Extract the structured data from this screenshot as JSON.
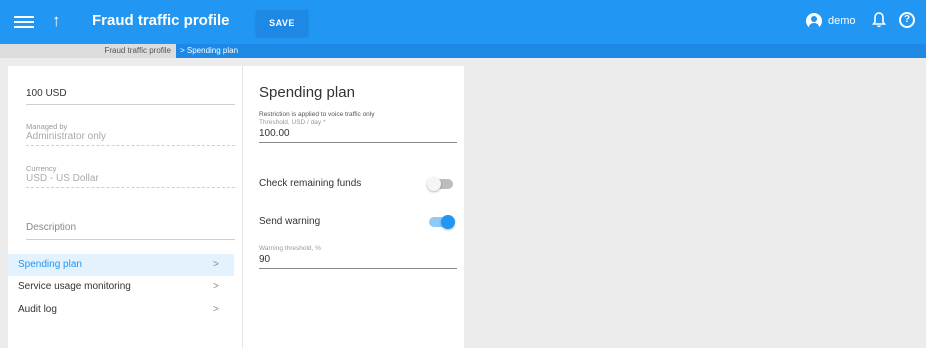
{
  "header": {
    "title": "Fraud traffic profile",
    "save_label": "SAVE",
    "user_name": "demo",
    "up_icon": "↑",
    "bell_icon": "🔔",
    "help_icon": "?",
    "accent_color": "#2196f3"
  },
  "breadcrumb": {
    "parent": "Fraud traffic profile",
    "current": "> Spending plan"
  },
  "left": {
    "amount": "100 USD",
    "managed_by_label": "Managed by",
    "managed_by_value": "Administrator only",
    "currency_label": "Currency",
    "currency_value": "USD - US Dollar",
    "description_placeholder": "Description",
    "nav": [
      {
        "label": "Spending plan",
        "active": true
      },
      {
        "label": "Service usage monitoring",
        "active": false
      },
      {
        "label": "Audit log",
        "active": false
      }
    ],
    "chevron": ">"
  },
  "spending_plan": {
    "title": "Spending plan",
    "note": "Restriction is applied to voice traffic only",
    "threshold_label": "Threshold, USD / day *",
    "threshold_value": "100.00",
    "check_funds_label": "Check remaining funds",
    "check_funds_on": false,
    "send_warning_label": "Send warning",
    "send_warning_on": true,
    "warning_threshold_label": "Warning threshold, %",
    "warning_threshold_value": "90"
  }
}
